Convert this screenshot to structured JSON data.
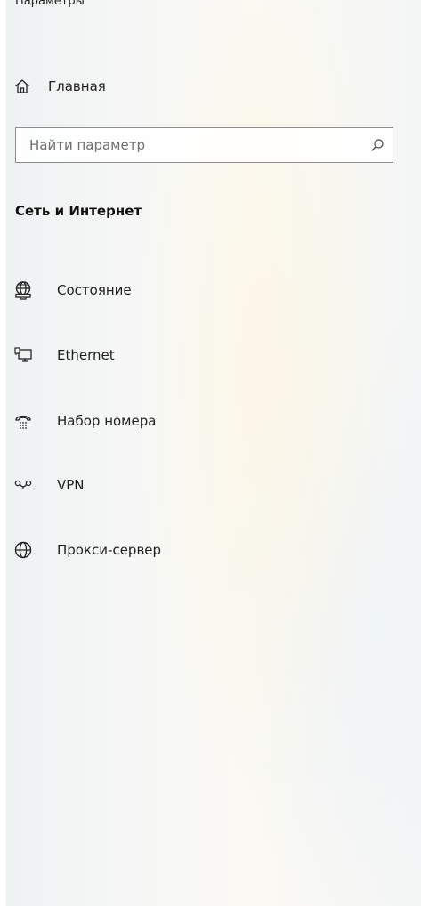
{
  "window": {
    "title": "Параметры"
  },
  "nav": {
    "home_label": "Главная"
  },
  "search": {
    "placeholder": "Найти параметр",
    "value": ""
  },
  "section": {
    "heading": "Сеть и Интернет"
  },
  "items": [
    {
      "label": "Состояние",
      "icon": "globe-network-icon"
    },
    {
      "label": "Ethernet",
      "icon": "ethernet-icon"
    },
    {
      "label": "Набор номера",
      "icon": "dial-up-icon"
    },
    {
      "label": "VPN",
      "icon": "vpn-icon"
    },
    {
      "label": "Прокси-сервер",
      "icon": "globe-icon"
    }
  ],
  "colors": {
    "text": "#1f1f1f",
    "search_border": "#8d8d8d",
    "placeholder": "#6f6f6f"
  }
}
